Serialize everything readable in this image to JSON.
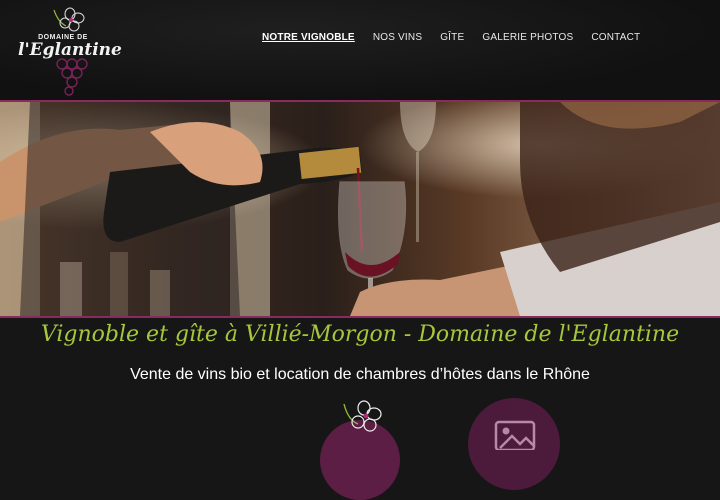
{
  "logo": {
    "line1": "DOMAINE DE",
    "line2": "l'Eglantine"
  },
  "nav": {
    "items": [
      "NOTRE VIGNOBLE",
      "NOS VINS",
      "GÎTE",
      "GALERIE PHOTOS",
      "CONTACT"
    ]
  },
  "hero": {
    "tagline": "Vignoble et gîte à Villié-Morgon - Domaine de l'Eglantine",
    "subtitle": "Vente de vins bio et location de chambres d’hôtes dans le Rhône"
  },
  "colors": {
    "accent_green": "#a6c63e",
    "accent_purple": "#8a2a5e",
    "background": "#161616"
  },
  "icons": [
    "flower-icon",
    "grapes-icon",
    "image-icon"
  ]
}
